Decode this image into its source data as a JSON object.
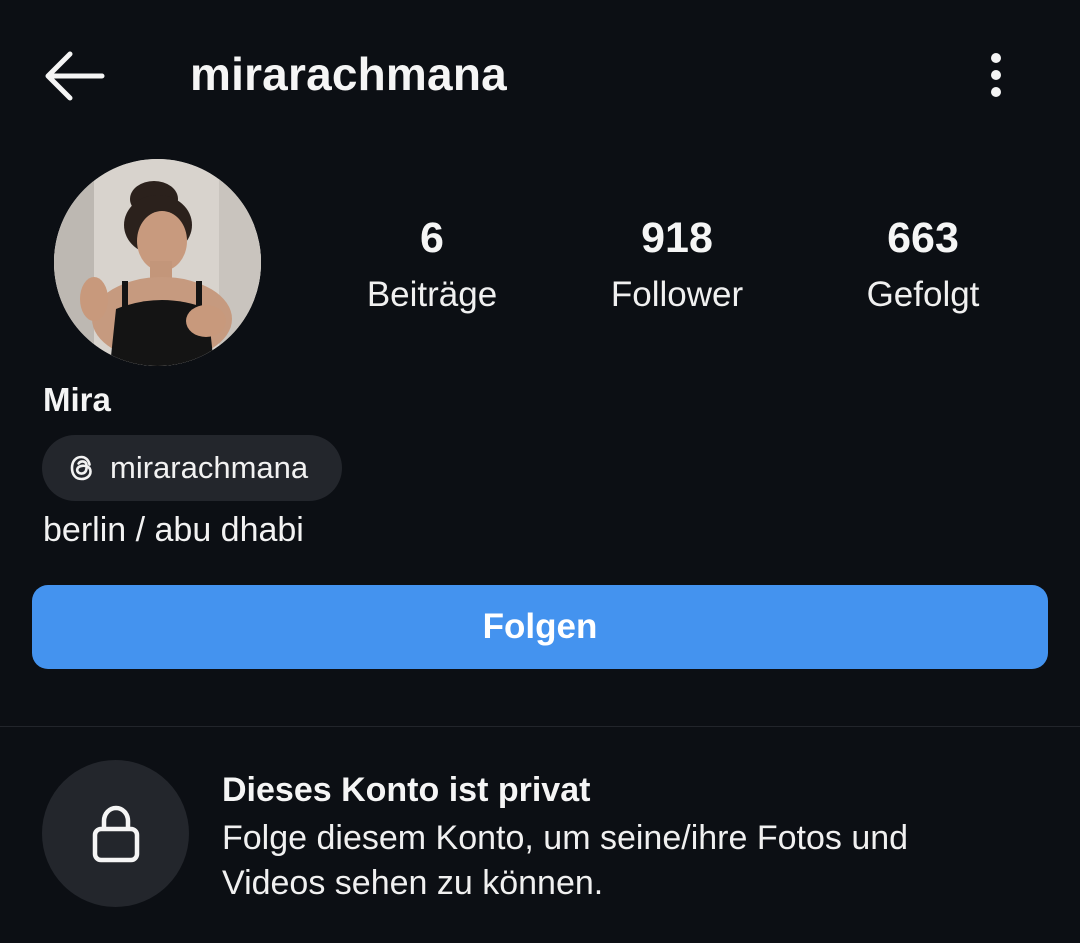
{
  "header": {
    "username": "mirarachmana",
    "back_icon": "arrow-left-icon",
    "more_icon": "more-vertical-icon"
  },
  "profile": {
    "avatar_icon": "profile-photo",
    "stats": [
      {
        "value": "6",
        "label": "Beiträge"
      },
      {
        "value": "918",
        "label": "Follower"
      },
      {
        "value": "663",
        "label": "Gefolgt"
      }
    ],
    "display_name": "Mira",
    "threads": {
      "icon": "threads-icon",
      "handle": "mirarachmana"
    },
    "bio": "berlin / abu dhabi"
  },
  "actions": {
    "follow_label": "Folgen",
    "follow_color": "#4493ef"
  },
  "private_notice": {
    "icon": "lock-icon",
    "title": "Dieses Konto ist privat",
    "description": "Folge diesem Konto, um seine/ihre Fotos und Videos sehen zu können."
  },
  "colors": {
    "background": "#0c0f14",
    "chip": "#23262c"
  }
}
